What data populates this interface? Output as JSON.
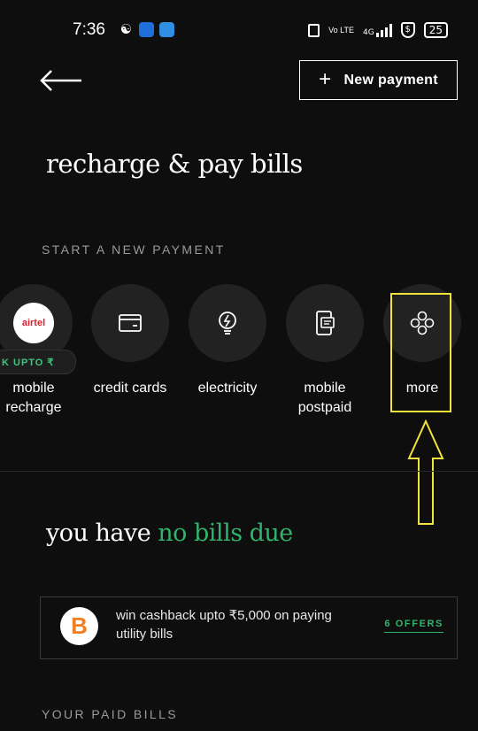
{
  "status_bar": {
    "time": "7:36",
    "volte": "Vo LTE",
    "network": "4G",
    "battery": "25",
    "icons": [
      "snapchat-icon",
      "app-icon-blue",
      "app-icon-files",
      "vibrate-icon",
      "volte-icon",
      "signal-icon",
      "vpn-shield-icon",
      "battery-icon"
    ]
  },
  "header": {
    "back_icon": "arrow-left-icon",
    "new_payment_label": "New payment",
    "new_payment_icon": "+"
  },
  "page_title": "recharge & pay bills",
  "start_section": {
    "label": "START A NEW PAYMENT",
    "airtel_logo": "airtel",
    "cashback_pill": "K   UPTO ₹",
    "items": [
      {
        "label_line1": "mobile",
        "label_line2": "recharge",
        "icon": "airtel-logo"
      },
      {
        "label_line1": "credit cards",
        "label_line2": "",
        "icon": "credit-card-icon"
      },
      {
        "label_line1": "electricity",
        "label_line2": "",
        "icon": "bulb-icon"
      },
      {
        "label_line1": "mobile",
        "label_line2": "postpaid",
        "icon": "postpaid-icon"
      },
      {
        "label_line1": "more",
        "label_line2": "",
        "icon": "more-icon"
      }
    ]
  },
  "bills": {
    "heading_prefix": "you have ",
    "heading_highlight": "no bills due"
  },
  "offer": {
    "logo_letter": "B",
    "text": "win cashback upto ₹5,000 on paying utility bills",
    "link_label": "6 OFFERS"
  },
  "paid_section": {
    "label": "YOUR PAID BILLS"
  },
  "colors": {
    "background": "#0e0e0e",
    "accent_green": "#31b36b",
    "highlight_yellow": "#f1e33a",
    "circle_bg": "#222222"
  }
}
